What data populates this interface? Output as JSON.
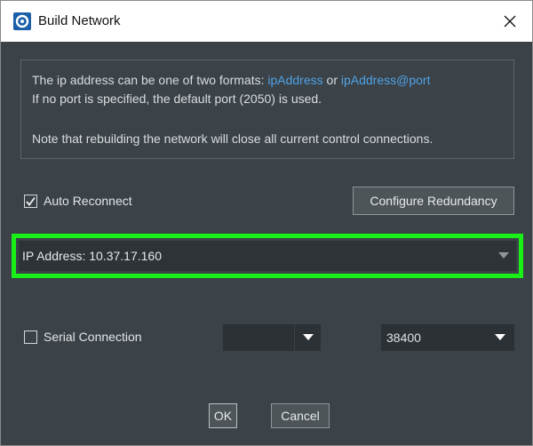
{
  "window": {
    "title": "Build Network",
    "close_glyph": "✕",
    "app_icon": "app-logo-icon"
  },
  "info": {
    "line1_prefix": "The ip address can be one of two formats: ",
    "format1": "ipAddress",
    "line1_mid": " or ",
    "format2": "ipAddress@port",
    "line2": "If no port is specified, the default port (2050) is used.",
    "line3": "Note that rebuilding the network will close all current control connections."
  },
  "auto_reconnect": {
    "label": "Auto Reconnect",
    "checked": true
  },
  "configure_redundancy": {
    "label": "Configure Redundancy"
  },
  "ip_address": {
    "value": "IP Address: 10.37.17.160"
  },
  "serial": {
    "label": "Serial Connection",
    "checked": false,
    "port_value": "",
    "baud_value": "38400"
  },
  "buttons": {
    "ok": "OK",
    "cancel": "Cancel"
  },
  "colors": {
    "background": "#3b4248",
    "link": "#4fa3e6",
    "highlight": "#18f018"
  }
}
